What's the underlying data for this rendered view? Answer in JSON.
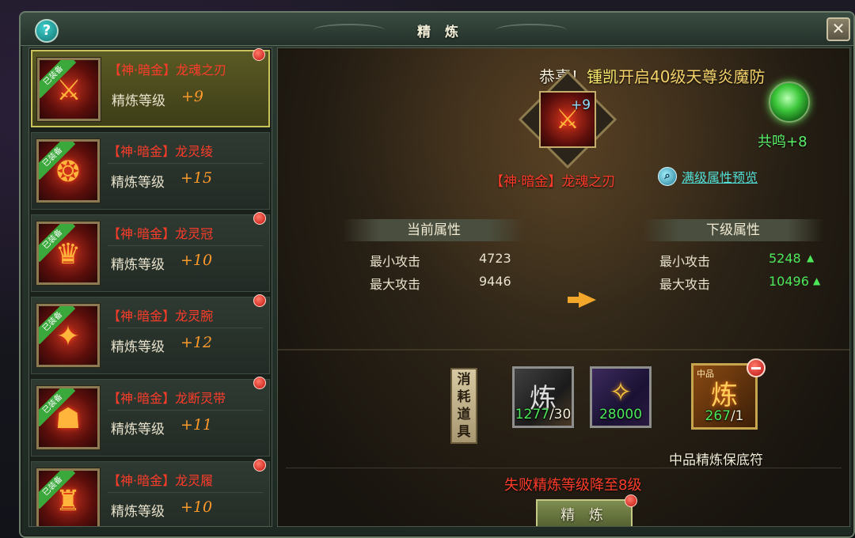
{
  "window": {
    "title": "精 炼",
    "help_label": "?",
    "close_label": "✕"
  },
  "equipment_list": [
    {
      "name": "【神·暗金】龙魂之刃",
      "level_label": "精炼等级",
      "level": "+9",
      "equipped_tag": "已装备",
      "selected": true,
      "has_red_dot": true
    },
    {
      "name": "【神·暗金】龙灵绫",
      "level_label": "精炼等级",
      "level": "+15",
      "equipped_tag": "已装备",
      "selected": false,
      "has_red_dot": false
    },
    {
      "name": "【神·暗金】龙灵冠",
      "level_label": "精炼等级",
      "level": "+10",
      "equipped_tag": "已装备",
      "selected": false,
      "has_red_dot": true
    },
    {
      "name": "【神·暗金】龙灵腕",
      "level_label": "精炼等级",
      "level": "+12",
      "equipped_tag": "已装备",
      "selected": false,
      "has_red_dot": true
    },
    {
      "name": "【神·暗金】龙断灵带",
      "level_label": "精炼等级",
      "level": "+11",
      "equipped_tag": "已装备",
      "selected": false,
      "has_red_dot": true
    },
    {
      "name": "【神·暗金】龙灵履",
      "level_label": "精炼等级",
      "level": "+10",
      "equipped_tag": "已装备",
      "selected": false,
      "has_red_dot": true
    }
  ],
  "broadcast": {
    "prefix": "恭喜！",
    "player": "锺凯",
    "message": "开启40级天尊炎魔防"
  },
  "resonance": {
    "label": "共鸣+8",
    "icon": "jade-orb-icon"
  },
  "selected_item": {
    "name": "【神·暗金】龙魂之刃",
    "level": "+9",
    "preview_link": "满级属性预览"
  },
  "attributes": {
    "current_header": "当前属性",
    "next_header": "下级属性",
    "rows": [
      {
        "label": "最小攻击",
        "current": "4723",
        "next": "5248"
      },
      {
        "label": "最大攻击",
        "current": "9446",
        "next": "10496"
      }
    ]
  },
  "consumables": {
    "label": "消耗道具",
    "items": [
      {
        "name": "refine-stone",
        "have": "1277",
        "need": "/30"
      },
      {
        "name": "gold-charm",
        "have": "28000",
        "need": ""
      }
    ],
    "guard": {
      "grade_tag": "中品",
      "have": "267",
      "need": "/1",
      "label": "中品精炼保底符"
    }
  },
  "fail_text": "失败精炼等级降至8级",
  "refine_button": "精 炼",
  "colors": {
    "item_name_red": "#ff3b2a",
    "level_orange": "#ff9a2a",
    "stat_up_green": "#4ce85a",
    "selected_border": "#c9c35c"
  }
}
